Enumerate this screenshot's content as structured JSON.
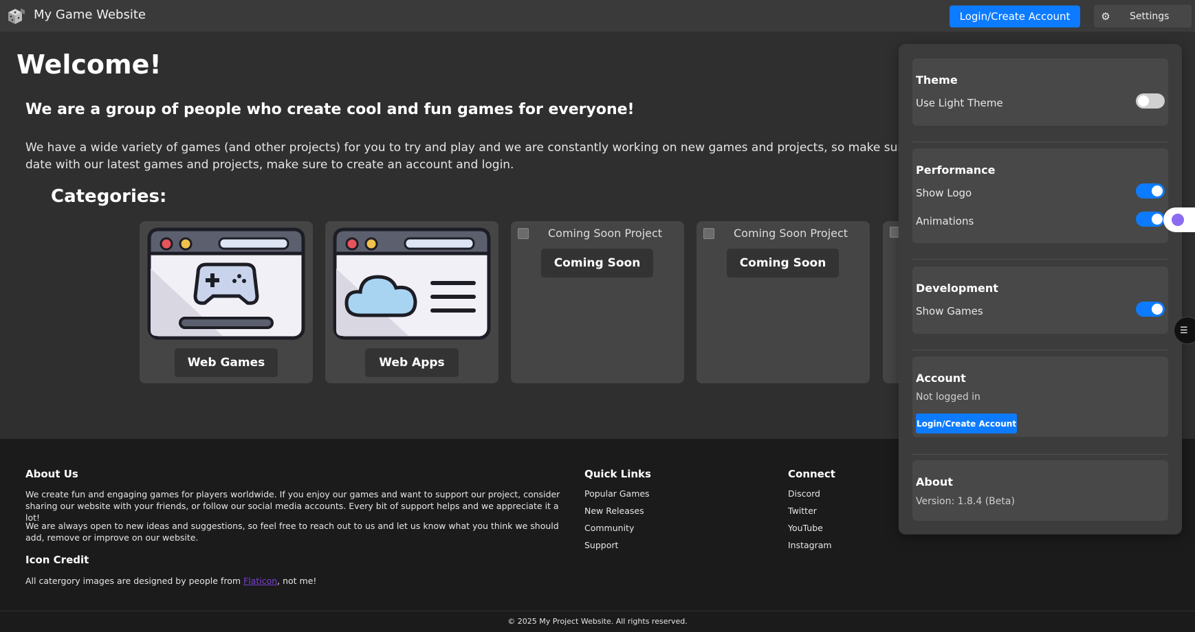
{
  "header": {
    "site_title": "My Game Website",
    "login_label": "Login/Create Account",
    "settings_label": "Settings",
    "settings_icon": "⚙"
  },
  "main": {
    "welcome": "Welcome!",
    "subtitle": "We are a group of people who create cool and fun games for everyone!",
    "intro": "We have a wide variety of games (and other projects) for you to try and play and we are constantly working on new games and projects, so make sure to date with our latest games and projects, make sure to create an account and login.",
    "categories_title": "Categories:",
    "cards": [
      {
        "label": "Web Games",
        "icon": "game-window"
      },
      {
        "label": "Web Apps",
        "icon": "cloud-window"
      },
      {
        "alt": "Coming Soon Project",
        "label": "Coming Soon"
      },
      {
        "alt": "Coming Soon Project",
        "label": "Coming Soon"
      }
    ]
  },
  "footer": {
    "about_title": "About Us",
    "about_p1": "We create fun and engaging games for players worldwide. If you enjoy our games and want to support our project, consider sharing our website with your friends, or follow our social media accounts. Every bit of support helps and we appreciate it a lot!",
    "about_p2": "We are always open to new ideas and suggestions, so feel free to reach out to us and let us know what you think we should add, remove or improve on our website.",
    "credit_title": "Icon Credit",
    "credit_pre": "All catergory images are designed by people from ",
    "credit_link": "Flaticon",
    "credit_post": ", not me!",
    "quick_title": "Quick Links",
    "quick_links": [
      "Popular Games",
      "New Releases",
      "Community",
      "Support"
    ],
    "connect_title": "Connect",
    "connect_links": [
      "Discord",
      "Twitter",
      "YouTube",
      "Instagram"
    ],
    "copyright": "© 2025 My Project Website. All rights reserved."
  },
  "settings_panel": {
    "theme_title": "Theme",
    "light_theme_label": "Use Light Theme",
    "light_theme_on": false,
    "performance_title": "Performance",
    "show_logo_label": "Show Logo",
    "show_logo_on": true,
    "animations_label": "Animations",
    "animations_on": true,
    "development_title": "Development",
    "show_games_label": "Show Games",
    "show_games_on": true,
    "account_title": "Account",
    "account_status": "Not logged in",
    "account_login_label": "Login/Create Account",
    "about_title": "About",
    "version": "Version: 1.8.4 (Beta)"
  },
  "colors": {
    "accent": "#0d7bff",
    "background": "#2f2f2f",
    "footer": "#1b1b1b",
    "panel": "#3c3c3c"
  }
}
